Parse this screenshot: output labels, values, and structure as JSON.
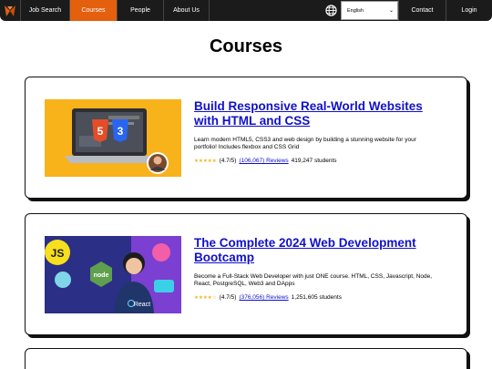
{
  "nav": {
    "logo_icon": "brand-logo-icon",
    "items": [
      {
        "label": "Job Search"
      },
      {
        "label": "Courses",
        "active": true
      },
      {
        "label": "People"
      },
      {
        "label": "About Us"
      }
    ],
    "globe_icon": "globe-icon",
    "language_selected": "English",
    "contact_label": "Contact",
    "login_label": "Login",
    "colors": {
      "background": "#1b1b1b",
      "active": "#e4600e"
    }
  },
  "page": {
    "title": "Courses"
  },
  "courses": [
    {
      "title": "Build Responsive Real-World Websites with HTML and CSS",
      "description": "Learn modern HTML5, CSS3 and web design by building a stunning website for your portfolio! Includes flexbox and CSS Grid",
      "stars": "★★★★★",
      "rating": "(4.7/5)",
      "reviews": "(106,067) Reviews",
      "students": "419,247 students"
    },
    {
      "title": "The Complete 2024 Web Development Bootcamp",
      "description": "Become a Full-Stack Web Developer with just ONE course. HTML, CSS, Javascript, Node, React, PostgreSQL, Web3 and DApps",
      "stars": "★★★★☆",
      "rating": "(4.7/5)",
      "reviews": "(376,056) Reviews",
      "students": "1,251,605 students"
    }
  ]
}
